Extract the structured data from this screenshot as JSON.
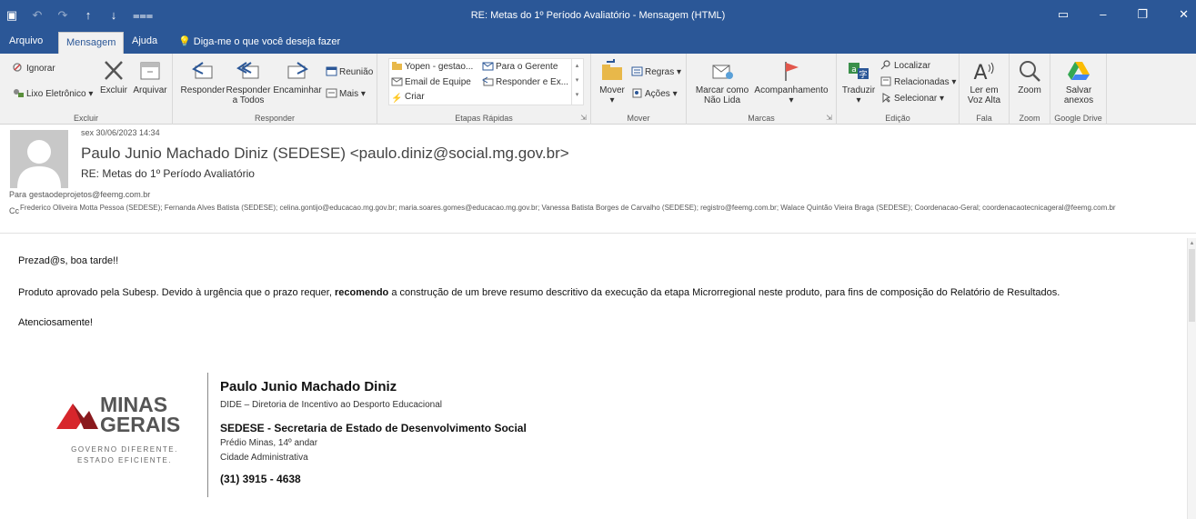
{
  "window": {
    "title": "RE: Metas do 1º Período Avaliatório  -  Mensagem (HTML)"
  },
  "tabs": [
    "Arquivo",
    "Mensagem",
    "Ajuda",
    "Diga-me o que você deseja fazer"
  ],
  "ribbon": {
    "excluir": {
      "label": "Excluir",
      "ignorar": "Ignorar",
      "lixo": "Lixo Eletrônico",
      "excluir_btn": "Excluir",
      "arquivar": "Arquivar"
    },
    "responder": {
      "label": "Responder",
      "responder": "Responder",
      "responder_todos": [
        "Responder",
        "a Todos"
      ],
      "encaminhar": "Encaminhar",
      "reuniao": "Reunião",
      "mais": "Mais"
    },
    "etapas": {
      "label": "Etapas Rápidas",
      "items": [
        "Yopen - gestao...",
        "Para o Gerente",
        "Email de Equipe",
        "Responder e Ex...",
        "Criar"
      ]
    },
    "mover": {
      "label": "Mover",
      "mover": "Mover",
      "regras": "Regras",
      "acoes": "Ações"
    },
    "marcas": {
      "label": "Marcas",
      "marcar": [
        "Marcar como",
        "Não Lida"
      ],
      "acompanhamento": "Acompanhamento"
    },
    "edicao": {
      "label": "Edição",
      "traduzir": "Traduzir",
      "localizar": "Localizar",
      "relacionadas": "Relacionadas",
      "selecionar": "Selecionar"
    },
    "fala": {
      "label": "Fala",
      "ler": [
        "Ler em",
        "Voz Alta"
      ]
    },
    "zoom": {
      "label": "Zoom",
      "zoom": "Zoom"
    },
    "gdrive": {
      "label": "Google Drive",
      "salvar": [
        "Salvar",
        "anexos"
      ]
    }
  },
  "header": {
    "date": "sex 30/06/2023 14:34",
    "from": "Paulo Junio Machado Diniz (SEDESE) <paulo.diniz@social.mg.gov.br>",
    "subject": "RE: Metas do 1º Período Avaliatório",
    "to_label": "Para",
    "to": "gestaodeprojetos@feemg.com.br",
    "cc_label": "Cc",
    "cc": "Frederico Oliveira Motta Pessoa (SEDESE); Fernanda Alves Batista (SEDESE); celina.gontijo@educacao.mg.gov.br; maria.soares.gomes@educacao.mg.gov.br; Vanessa Batista Borges de Carvalho (SEDESE); registro@feemg.com.br; Walace Quintão Vieira Braga (SEDESE); Coordenacao-Geral; coordenacaotecnicageral@feemg.com.br"
  },
  "body": {
    "greeting": "Prezad@s, boa tarde!!",
    "p1_before": "Produto aprovado pela Subesp. Devido à urgência que o prazo requer, ",
    "p1_bold": "recomendo",
    "p1_after": " a construção de um breve resumo descritivo da execução da etapa Microrregional neste produto, para fins de composição do Relatório de Resultados.",
    "closing": "Atenciosamente!"
  },
  "signature": {
    "logo_text": [
      "MINAS",
      "GERAIS"
    ],
    "logo_tagline": [
      "GOVERNO DIFERENTE.",
      "ESTADO EFICIENTE."
    ],
    "name": "Paulo Junio Machado Diniz",
    "dept": "DIDE – Diretoria de Incentivo ao Desporto Educacional",
    "org": "SEDESE - Secretaria de Estado de Desenvolvimento Social",
    "addr1": "Prédio Minas, 14º andar",
    "addr2": "Cidade Administrativa",
    "phone": "(31) 3915 - 4638"
  },
  "colors": {
    "titlebar": "#2b5797",
    "ribbon": "#f1f1f1",
    "logo_red": "#d7262c",
    "logo_gray": "#555555"
  }
}
